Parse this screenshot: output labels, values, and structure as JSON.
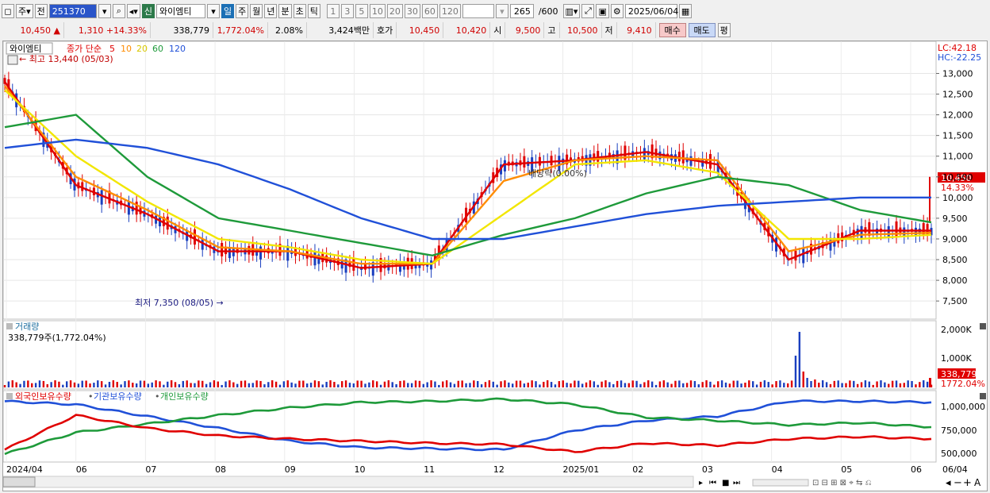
{
  "toolbar": {
    "period_type": "주",
    "prev_label": "전",
    "stock_code": "251370",
    "new_tag": "신",
    "stock_name": "와이엠티",
    "periods": [
      "일",
      "주",
      "월",
      "년",
      "분",
      "초",
      "틱"
    ],
    "selected_period": "일",
    "intervals": [
      "1",
      "3",
      "5",
      "10",
      "20",
      "30",
      "60",
      "120"
    ],
    "count": "265",
    "count_max": "/600",
    "date": "2025/06/04"
  },
  "quote": {
    "price": "10,450",
    "arrow": "▲",
    "change": "1,310",
    "change_pct": "+14.33%",
    "volume": "338,779",
    "volume_pct": "1,772.04%",
    "turnover_pct": "2.08%",
    "amount": "3,424백만",
    "ask_label": "호가",
    "ask": "10,450",
    "bid": "10,420",
    "open_label": "시",
    "open": "9,500",
    "high_label": "고",
    "high": "10,500",
    "low_label": "저",
    "low": "9,410",
    "buy_label": "매수",
    "sell_label": "매도",
    "avg_label": "평"
  },
  "price_panel": {
    "stock_name": "와이엠티",
    "ma_title": "종가 단순",
    "ma_periods": [
      "5",
      "10",
      "20",
      "60",
      "120"
    ],
    "ma_colors": [
      "#e00000",
      "#ff8c00",
      "#f2e600",
      "#1e9a3a",
      "#2050d8"
    ],
    "lc": "LC:42.18",
    "hc": "HC:-22.25",
    "high_note": "최고 13,440 (05/03)",
    "low_note": "최저 7,350 (08/05)",
    "dividend_note": "배당락(0.00%)",
    "current_price": "10,450",
    "current_pct": "14.33%",
    "y_ticks": [
      "13,000",
      "12,500",
      "12,000",
      "11,500",
      "11,000",
      "10,500",
      "10,000",
      "9,500",
      "9,000",
      "8,500",
      "8,000",
      "7,500"
    ]
  },
  "volume_panel": {
    "title": "거래량",
    "value": "338,779주(1,772.04%)",
    "y_ticks": [
      "2,000K",
      "1,000K"
    ],
    "current": "338,779",
    "current_pct": "1772.04%"
  },
  "holding_panel": {
    "legend": [
      "외국인보유수량",
      "기관보유수량",
      "개인보유수량"
    ],
    "colors": [
      "#e00000",
      "#2050d8",
      "#1e9a3a"
    ],
    "y_ticks": [
      "1,000,000",
      "750,000",
      "500,000"
    ]
  },
  "x_axis": [
    "2024/04",
    "06",
    "07",
    "08",
    "09",
    "10",
    "11",
    "12",
    "2025/01",
    "02",
    "03",
    "04",
    "05",
    "06",
    "06/04"
  ],
  "chart_data": {
    "type": "line",
    "title": "와이엠티",
    "x": [
      "2024/04",
      "06",
      "07",
      "08",
      "09",
      "10",
      "11",
      "12",
      "2025/01",
      "02",
      "03",
      "04",
      "05",
      "06"
    ],
    "series": [
      {
        "name": "5",
        "values": [
          12800,
          10300,
          9600,
          8700,
          8700,
          8300,
          8400,
          10800,
          10900,
          11100,
          10800,
          8500,
          9200,
          9200
        ]
      },
      {
        "name": "10",
        "values": [
          12700,
          10500,
          9700,
          8800,
          8700,
          8400,
          8400,
          10400,
          10900,
          11000,
          10900,
          8700,
          9100,
          9150
        ]
      },
      {
        "name": "20",
        "values": [
          12600,
          11000,
          9900,
          9000,
          8800,
          8500,
          8400,
          9600,
          10800,
          10900,
          10600,
          9000,
          9000,
          9100
        ]
      },
      {
        "name": "60",
        "values": [
          11700,
          12000,
          10500,
          9500,
          9200,
          8900,
          8600,
          9100,
          9500,
          10100,
          10500,
          10300,
          9700,
          9400
        ]
      },
      {
        "name": "120",
        "values": [
          11200,
          11400,
          11200,
          10800,
          10200,
          9500,
          9000,
          9000,
          9300,
          9600,
          9800,
          9900,
          10000,
          10000
        ]
      }
    ],
    "ylim": [
      7100,
      13700
    ],
    "high": 13440,
    "low": 7350,
    "last": 10450
  }
}
